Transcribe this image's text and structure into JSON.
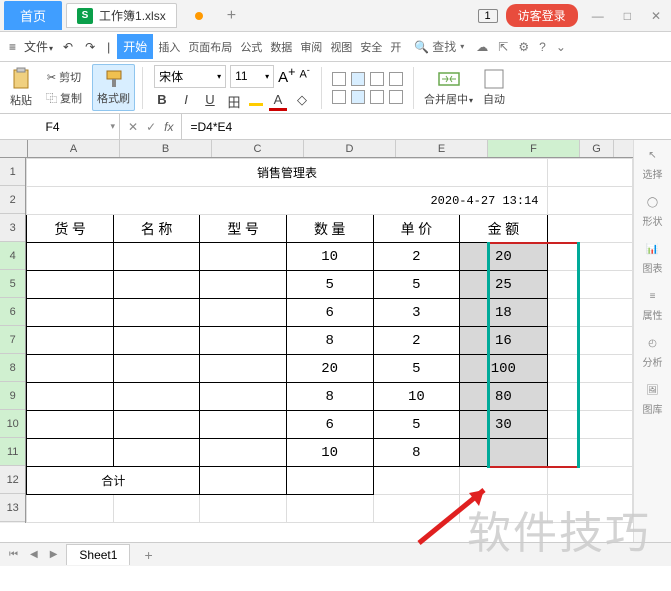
{
  "titlebar": {
    "home_tab": "首页",
    "wps_badge": "S",
    "file_name": "工作簿1.xlsx",
    "add_tab": "+",
    "badge": "1",
    "guest_login": "访客登录",
    "min": "—",
    "max": "□",
    "close": "✕"
  },
  "menubar": {
    "hamburger": "≡",
    "file": "文件",
    "start": "开始",
    "insert": "插入",
    "page_layout": "页面布局",
    "formula": "公式",
    "data": "数据",
    "review": "审阅",
    "view": "视图",
    "security": "安全",
    "extra": "开",
    "search_icon": "🔍",
    "search_label": "查找"
  },
  "ribbon": {
    "paste": "粘贴",
    "cut": "剪切",
    "copy": "复制",
    "format_painter": "格式刷",
    "font_name": "宋体",
    "font_size": "11",
    "a_large": "A",
    "a_small": "A",
    "bold": "B",
    "italic": "I",
    "underline": "U",
    "merge_center": "合并居中",
    "auto": "自动"
  },
  "formula_bar": {
    "name_box": "F4",
    "fx": "fx",
    "formula": "=D4*E4"
  },
  "sheet": {
    "cols": [
      "A",
      "B",
      "C",
      "D",
      "E",
      "F",
      "G"
    ],
    "rows": [
      "1",
      "2",
      "3",
      "4",
      "5",
      "6",
      "7",
      "8",
      "9",
      "10",
      "11",
      "12",
      "13"
    ],
    "title": "销售管理表",
    "datetime": "2020-4-27 13:14",
    "headers": {
      "code": "货  号",
      "name": "名  称",
      "model": "型  号",
      "qty": "数  量",
      "price": "单  价",
      "amount": "金  额"
    },
    "data": [
      {
        "qty": "10",
        "price": "2",
        "amount": "20"
      },
      {
        "qty": "5",
        "price": "5",
        "amount": "25"
      },
      {
        "qty": "6",
        "price": "3",
        "amount": "18"
      },
      {
        "qty": "8",
        "price": "2",
        "amount": "16"
      },
      {
        "qty": "20",
        "price": "5",
        "amount": "100"
      },
      {
        "qty": "8",
        "price": "10",
        "amount": "80"
      },
      {
        "qty": "6",
        "price": "5",
        "amount": "30"
      },
      {
        "qty": "10",
        "price": "8",
        "amount": ""
      }
    ],
    "total_label": "合计"
  },
  "rightbar": {
    "select": "选择",
    "shape": "形状",
    "chart": "图表",
    "attr": "属性",
    "analyze": "分析",
    "gallery": "图库"
  },
  "tabs": {
    "sheet_name": "Sheet1",
    "add": "+"
  },
  "watermark": "软件技巧"
}
